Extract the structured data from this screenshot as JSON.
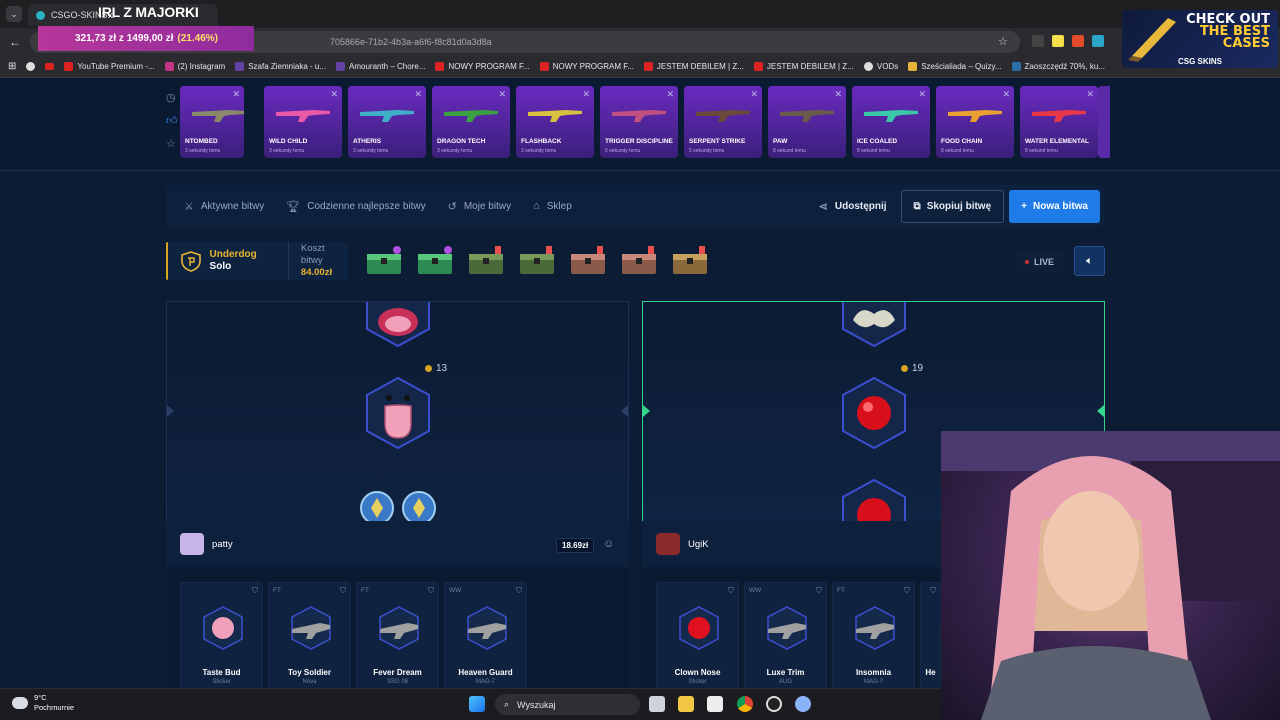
{
  "browser": {
    "tab_title": "CSGO-SKINS.c",
    "url": "705866e-71b2-4b3a-a6f6-f8c81d0a3d8a",
    "bookmarks": [
      "YouTube Premium -...",
      "(2) Instagram",
      "Szafa Ziemniaka - u...",
      "Amouranth – Chore...",
      "NOWY PROGRAM F...",
      "NOWY PROGRAM F...",
      "JESTEM DEBILEM | Z...",
      "JESTEM DEBILEM | Z...",
      "VODs",
      "Sześcialiada – Quizy...",
      "Zaoszczędź 70%, ku..."
    ],
    "other_bookmarks": "Wszystkie zakładki"
  },
  "overlay": {
    "title": "IRL Z MAJORKI",
    "goal_text": "321,73 zł z 1499,00 zł",
    "goal_percent": "(21.46%)"
  },
  "ad": {
    "line1": "CHECK OUT",
    "line2": "THE BEST",
    "line3": "CASES",
    "logo": "CSG SKINS"
  },
  "feed": {
    "cards": [
      {
        "name": "NTOMBED",
        "time": "3 sekundy temu"
      },
      {
        "name": "WILD CHILD",
        "time": "3 sekundy temu"
      },
      {
        "name": "ATHERIS",
        "time": "3 sekundy temu"
      },
      {
        "name": "DRAGON TECH",
        "time": "3 sekundy temu"
      },
      {
        "name": "FLASHBACK",
        "time": "3 sekundy temu"
      },
      {
        "name": "TRIGGER DISCIPLINE",
        "time": "5 sekundy temu"
      },
      {
        "name": "SERPENT STRIKE",
        "time": "5 sekundy temu"
      },
      {
        "name": "PAW",
        "time": "8 sekund temu"
      },
      {
        "name": "ICE COALED",
        "time": "8 sekund temu"
      },
      {
        "name": "FOOD CHAIN",
        "time": "8 sekund temu"
      },
      {
        "name": "WATER ELEMENTAL",
        "time": "8 sekund temu"
      }
    ]
  },
  "nav": {
    "active_battles": "Aktywne bitwy",
    "daily_best": "Codzienne najlepsze bitwy",
    "my_battles": "Moje bitwy",
    "shop": "Sklep",
    "share": "Udostępnij",
    "copy_battle": "Skopiuj bitwę",
    "new_battle": "Nowa bitwa"
  },
  "battle": {
    "mode_line1": "Underdog",
    "mode_line2": "Solo",
    "cost_label": "Koszt bitwy",
    "cost_value": "84.00zł",
    "live": "LIVE",
    "left_count": "13",
    "right_count": "19"
  },
  "players": {
    "left": {
      "name": "patty",
      "value": "18.69zł",
      "items": [
        {
          "quality": "",
          "name": "Taste Bud",
          "type": "Sticker"
        },
        {
          "quality": "FT",
          "name": "Toy Soldier",
          "type": "Nova"
        },
        {
          "quality": "FT",
          "name": "Fever Dream",
          "type": "SSG 08"
        },
        {
          "quality": "WW",
          "name": "Heaven Guard",
          "type": "MAG-7"
        }
      ]
    },
    "right": {
      "name": "UgiK",
      "items": [
        {
          "quality": "",
          "name": "Clown Nose",
          "type": "Sticker"
        },
        {
          "quality": "WW",
          "name": "Luxe Trim",
          "type": "AUG"
        },
        {
          "quality": "FT",
          "name": "Insomnia",
          "type": "MAG-7"
        },
        {
          "quality": "",
          "name": "He",
          "type": ""
        }
      ]
    }
  },
  "taskbar": {
    "temp": "9°C",
    "weather": "Pochmurnie",
    "search": "Wyszukaj"
  },
  "colors": {
    "accent_blue": "#1e7be8",
    "gold": "#e9b534",
    "green": "#34d48d",
    "purple": "#6a2bbf"
  }
}
